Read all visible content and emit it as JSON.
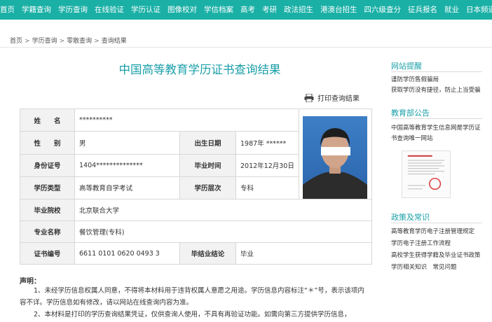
{
  "nav": {
    "items": [
      "首页",
      "学籍查询",
      "学历查询",
      "在线验证",
      "学历认证",
      "图像校对",
      "学信档案",
      "高考",
      "考研",
      "政法招生",
      "港澳台招生",
      "四六级查分",
      "征兵报名",
      "就业",
      "日本频道"
    ]
  },
  "breadcrumb": [
    "首页",
    "学历查询",
    "零散查询",
    "查询结果"
  ],
  "main": {
    "title": "中国高等教育学历证书查询结果",
    "print_label": "打印查询结果"
  },
  "result": {
    "name_label": "姓　　名",
    "name_value": "**********",
    "gender_label": "性　　别",
    "gender_value": "男",
    "birth_label": "出生日期",
    "birth_value": "1987年 ******",
    "id_label": "身份证号",
    "id_value": "1404**************",
    "grad_time_label": "毕业时间",
    "grad_time_value": "2012年12月30日",
    "type_label": "学历类型",
    "type_value": "高等教育自学考试",
    "level_label": "学历层次",
    "level_value": "专科",
    "school_label": "毕业院校",
    "school_value": "北京联合大学",
    "major_label": "专业名称",
    "major_value": "餐饮管理(专科)",
    "cert_label": "证书编号",
    "cert_value": "6611 0101 0620 0493 3",
    "conclusion_label": "毕结业结论",
    "conclusion_value": "毕业"
  },
  "declaration": {
    "title": "声明：",
    "p1": "1、未经学历信息权属人同意，不得将本材料用于违背权属人意愿之用途。学历信息内容标注“＊”号，表示该项内容不详。学历信息如有修改，请以网站在线查询内容为准。",
    "p2": "2、本材料是打印的学历查询结果凭证，仅供查询人使用，不具有再验证功能。如需向第三方提供学历信息，"
  },
  "sidebar": {
    "alert_heading": "网站提醒",
    "alert_links": [
      "谨防学历售假骗局",
      "获取学历没有捷径，防止上当受骗"
    ],
    "notice_heading": "教育部公告",
    "notice_text_1": "中国高等教育学生信息网是学历证",
    "notice_text_2": "书查询唯一网站",
    "policy_heading": "政策及常识",
    "policy_links": [
      "高等教育学历电子注册管理规定",
      "学历电子注册工作流程",
      "高校学生获得学籍及毕业证书政策",
      "学历相关知识　常见问题"
    ]
  },
  "colors": {
    "accent": "#1ab0a6",
    "title": "#1a9fa8"
  }
}
